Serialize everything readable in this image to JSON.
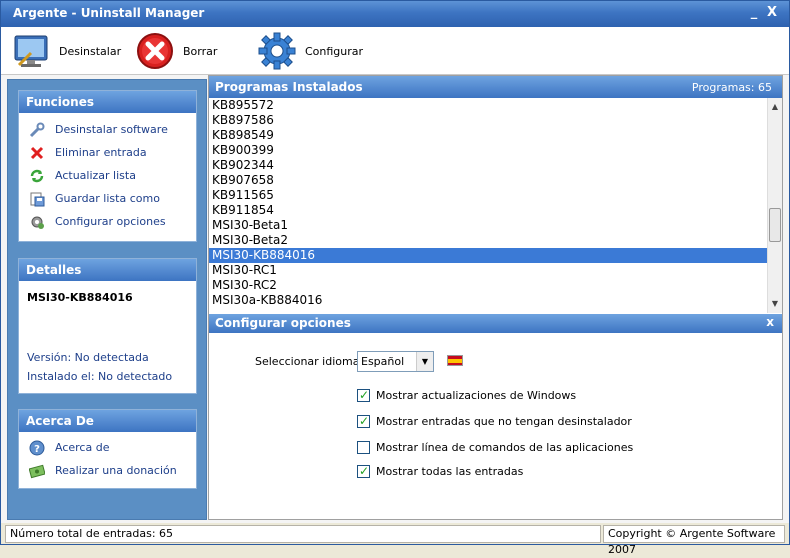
{
  "window": {
    "title": "Argente - Uninstall Manager",
    "minimize_label": "_",
    "close_label": "X"
  },
  "toolbar": {
    "uninstall_label": "Desinstalar",
    "delete_label": "Borrar",
    "configure_label": "Configurar"
  },
  "funciones": {
    "title": "Funciones",
    "items": [
      {
        "label": "Desinstalar software",
        "icon": "wrench-icon"
      },
      {
        "label": "Eliminar entrada",
        "icon": "red-x-icon"
      },
      {
        "label": "Actualizar lista",
        "icon": "refresh-icon"
      },
      {
        "label": "Guardar lista como",
        "icon": "save-list-icon"
      },
      {
        "label": "Configurar opciones",
        "icon": "gear-icon"
      }
    ]
  },
  "detalles": {
    "title": "Detalles",
    "name": "MSI30-KB884016",
    "version": "Versión: No detectada",
    "installed": "Instalado el: No detectado"
  },
  "acerca": {
    "title": "Acerca De",
    "items": [
      {
        "label": "Acerca de",
        "icon": "help-icon"
      },
      {
        "label": "Realizar una donación",
        "icon": "money-icon"
      }
    ]
  },
  "programs": {
    "title": "Programas Instalados",
    "count": "Programas: 65",
    "items": [
      "KB895572",
      "KB897586",
      "KB898549",
      "KB900399",
      "KB902344",
      "KB907658",
      "KB911565",
      "KB911854",
      "MSI30-Beta1",
      "MSI30-Beta2",
      "MSI30-KB884016",
      "MSI30-RC1",
      "MSI30-RC2",
      "MSI30a-KB884016"
    ],
    "selected": "MSI30-KB884016"
  },
  "config": {
    "title": "Configurar opciones",
    "close_label": "x",
    "language_label": "Seleccionar idioma:",
    "language_value": "Español",
    "options": [
      {
        "label": "Mostrar actualizaciones de Windows",
        "checked": true
      },
      {
        "label": "Mostrar entradas que no tengan desinstalador",
        "checked": true
      },
      {
        "label": "Mostrar línea de comandos de las aplicaciones",
        "checked": false
      },
      {
        "label": "Mostrar todas las entradas",
        "checked": true
      }
    ]
  },
  "status": {
    "total": "Número total de entradas: 65",
    "copyright": "Copyright © Argente Software 2007"
  }
}
